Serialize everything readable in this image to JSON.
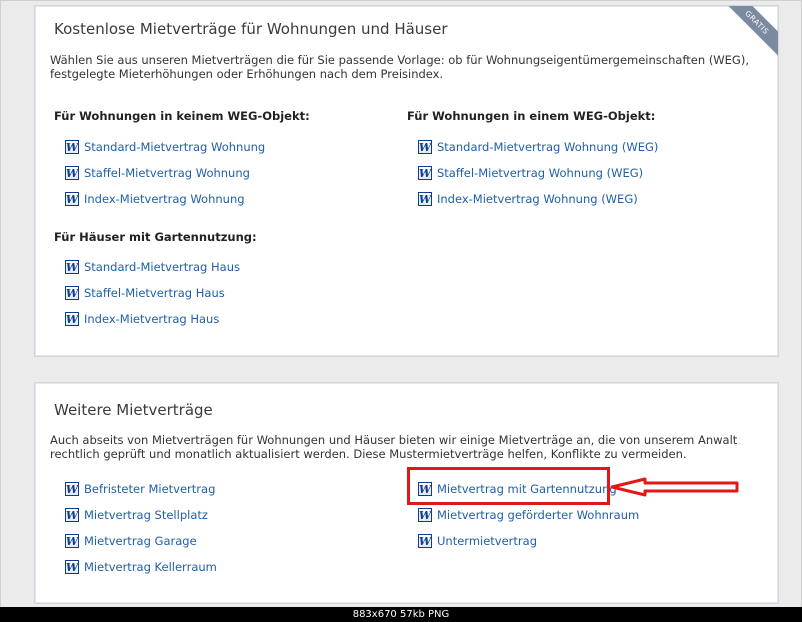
{
  "panel1": {
    "title": "Kostenlose Mietverträge für Wohnungen und Häuser",
    "ribbon": "GRATIS",
    "intro": "Wählen Sie aus unseren Mietverträgen die für Sie passende Vorlage: ob für Wohnungseigentümergemeinschaften (WEG), festgelegte Mieterhöhungen oder Erhöhungen nach dem Preisindex.",
    "sections": [
      {
        "heading": "Für Wohnungen in keinem WEG-Objekt:",
        "items": [
          "Standard-Mietvertrag Wohnung",
          "Staffel-Mietvertrag Wohnung",
          "Index-Mietvertrag Wohnung"
        ]
      },
      {
        "heading": "Für Wohnungen in einem WEG-Objekt:",
        "items": [
          "Standard-Mietvertrag Wohnung (WEG)",
          "Staffel-Mietvertrag Wohnung (WEG)",
          "Index-Mietvertrag Wohnung (WEG)"
        ]
      },
      {
        "heading": "Für Häuser mit Gartennutzung:",
        "items": [
          "Standard-Mietvertrag Haus",
          "Staffel-Mietvertrag Haus",
          "Index-Mietvertrag Haus"
        ]
      }
    ]
  },
  "panel2": {
    "title": "Weitere Mietverträge",
    "intro": "Auch abseits von Mietverträgen für Wohnungen und Häuser bieten wir einige Mietverträge an, die von unserem Anwalt rechtlich geprüft und monatlich aktualisiert werden. Diese Mustermietverträge helfen, Konflikte zu vermeiden.",
    "left_items": [
      "Befristeter Mietvertrag",
      "Mietvertrag Stellplatz",
      "Mietvertrag Garage",
      "Mietvertrag Kellerraum"
    ],
    "right_items": [
      "Mietvertrag mit Gartennutzung",
      "Mietvertrag geförderter Wohnraum",
      "Untermietvertrag"
    ]
  },
  "icon": {
    "name": "word-document-icon",
    "glyph": "W",
    "color": "#0f3c8c"
  },
  "link_color": "#1f5fa9",
  "highlight_color": "#e01818",
  "status_bar": "883x670  57kb  PNG"
}
